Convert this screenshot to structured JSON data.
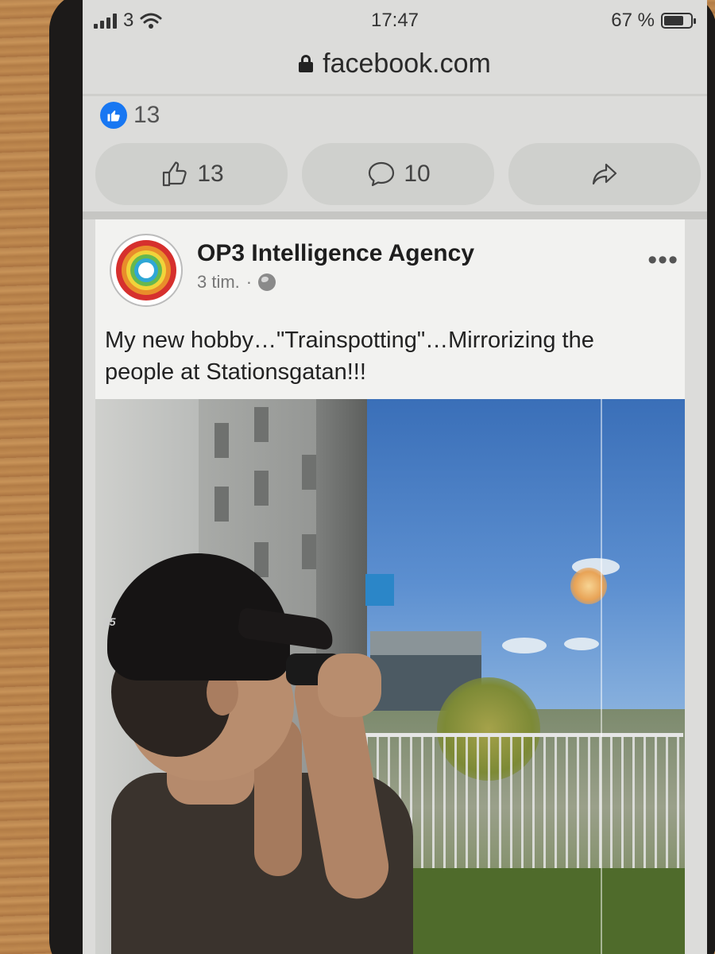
{
  "status_bar": {
    "carrier": "3",
    "time": "17:47",
    "battery": "67 %"
  },
  "browser": {
    "url": "facebook.com"
  },
  "previous_post": {
    "reaction_count": "13",
    "like_count": "13",
    "comment_count": "10"
  },
  "post": {
    "author": "OP3 Intelligence Agency",
    "time": "3 tim.",
    "separator": "·",
    "more": "•••",
    "text": "My new hobby…\"Trainspotting\"…Mirrorizing the people at Stationsgatan!!!",
    "photo_tag": "35"
  },
  "icons": {
    "signal": "signal-icon",
    "wifi": "wifi-icon",
    "battery": "battery-icon",
    "lock": "lock-icon",
    "like_badge": "like-badge-icon",
    "like": "thumbs-up-icon",
    "comment": "comment-icon",
    "share": "share-icon",
    "globe": "globe-icon",
    "more": "more-icon"
  },
  "colors": {
    "facebook_blue": "#1877f2"
  }
}
